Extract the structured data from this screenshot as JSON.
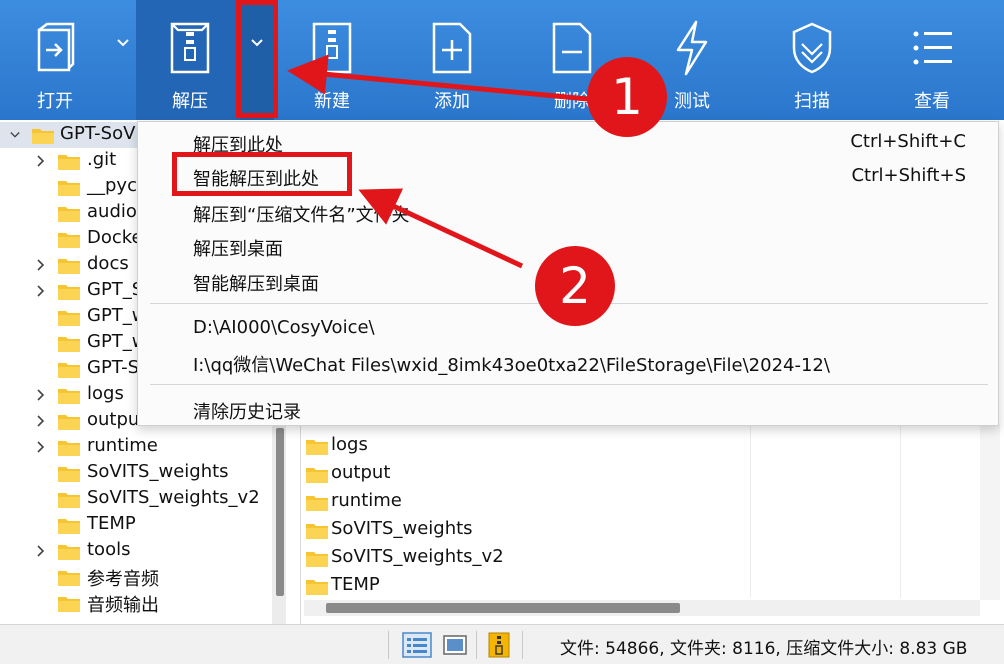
{
  "toolbar": {
    "open": "打开",
    "extract": "解压",
    "new": "新建",
    "add": "添加",
    "delete": "删除",
    "test": "测试",
    "scan": "扫描",
    "view": "查看"
  },
  "tree": {
    "root": "GPT-SoV",
    "items": [
      ".git",
      "__pyc",
      "audio",
      "Docke",
      "docs",
      "GPT_S",
      "GPT_w",
      "GPT_w",
      "GPT-S",
      "logs",
      "outpu",
      "runtime",
      "SoVITS_weights",
      "SoVITS_weights_v2",
      "TEMP",
      "tools",
      "参考音频",
      "音频输出"
    ]
  },
  "files": [
    "logs",
    "output",
    "runtime",
    "SoVITS_weights",
    "SoVITS_weights_v2",
    "TEMP"
  ],
  "menu": {
    "items": [
      {
        "label": "解压到此处",
        "shortcut": "Ctrl+Shift+C"
      },
      {
        "label": "智能解压到此处",
        "shortcut": "Ctrl+Shift+S"
      },
      {
        "label": "解压到“压缩文件名”文件夹",
        "shortcut": ""
      },
      {
        "label": "解压到桌面",
        "shortcut": ""
      },
      {
        "label": "智能解压到桌面",
        "shortcut": ""
      }
    ],
    "recent": [
      "D:\\AI000\\CosyVoice\\",
      "I:\\qq微信\\WeChat Files\\wxid_8imk43oe0txa22\\FileStorage\\File\\2024-12\\"
    ],
    "clear_history": "清除历史记录"
  },
  "annotations": {
    "badge1": "1",
    "badge2": "2"
  },
  "status": {
    "summary": "文件: 54866, 文件夹: 8116, 压缩文件大小: 8.83 GB"
  },
  "colors": {
    "toolbar": "#2a76cc",
    "annotation": "#e0161a",
    "folder": "#f7c531"
  }
}
